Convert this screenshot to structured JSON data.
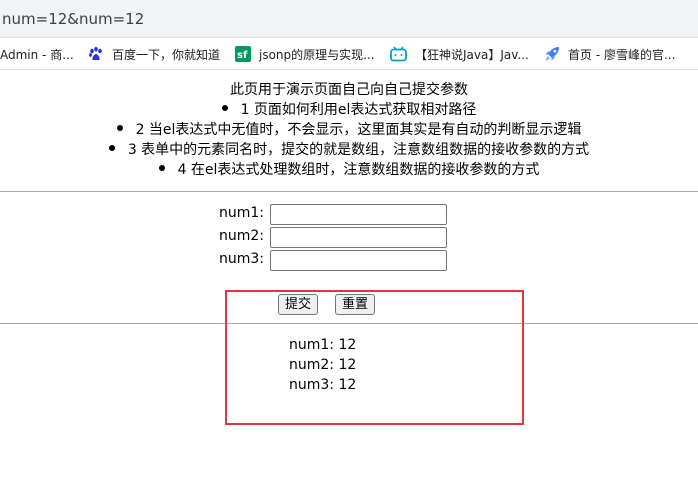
{
  "browser": {
    "url": "num=12&num=12",
    "bookmarks": [
      {
        "label": "Admin - 商...",
        "icon": "none"
      },
      {
        "label": "百度一下，你就知道",
        "icon": "baidu-paw-icon"
      },
      {
        "label": "jsonp的原理与实现...",
        "icon": "segmentfault-icon"
      },
      {
        "label": "【狂神说Java】Jav...",
        "icon": "bilibili-tv-icon"
      },
      {
        "label": "首页 - 廖雪峰的官...",
        "icon": "rocket-icon"
      }
    ]
  },
  "intro": {
    "title": "此页用于演示页面自己向自己提交参数",
    "items": [
      "1 页面如何利用el表达式获取相对路径",
      "2 当el表达式中无值时，不会显示，这里面其实是有自动的判断显示逻辑",
      "3 表单中的元素同名时，提交的就是数组，注意数组数据的接收参数的方式",
      "4 在el表达式处理数组时，注意数组数据的接收参数的方式"
    ]
  },
  "form": {
    "fields": [
      {
        "label": "num1:",
        "value": ""
      },
      {
        "label": "num2:",
        "value": ""
      },
      {
        "label": "num3:",
        "value": ""
      }
    ],
    "submit_label": "提交",
    "reset_label": "重置"
  },
  "results": [
    "num1: 12",
    "num2: 12",
    "num3: 12"
  ],
  "colors": {
    "highlight_box": "#e0363c",
    "baidu_blue": "#2932e1",
    "segmentfault_green": "#009a61",
    "bilibili_blue": "#00a1d6",
    "rocket_blue": "#3b7cff"
  }
}
